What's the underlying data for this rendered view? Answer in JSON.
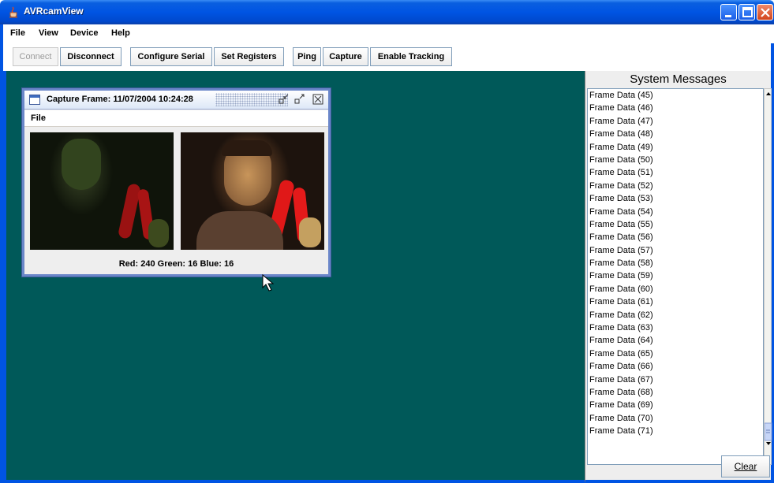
{
  "window": {
    "title": "AVRcamView"
  },
  "menubar": {
    "items": [
      {
        "label": "File",
        "mnemonic": "F"
      },
      {
        "label": "View",
        "mnemonic": "V"
      },
      {
        "label": "Device",
        "mnemonic": "D"
      },
      {
        "label": "Help",
        "mnemonic": "H"
      }
    ]
  },
  "toolbar": {
    "connect": "Connect",
    "disconnect": "Disconnect",
    "configure_serial": "Configure Serial",
    "set_registers": "Set Registers",
    "ping": "Ping",
    "capture": "Capture",
    "enable_tracking": "Enable Tracking"
  },
  "capture_frame": {
    "title": "Capture Frame: 11/07/2004 10:24:28",
    "menu_file": "File",
    "rgb_readout": "Red: 240 Green: 16 Blue: 16"
  },
  "system_messages": {
    "heading": "System Messages",
    "messages": [
      "Frame Data (45)",
      "Frame Data (46)",
      "Frame Data (47)",
      "Frame Data (48)",
      "Frame Data (49)",
      "Frame Data (50)",
      "Frame Data (51)",
      "Frame Data (52)",
      "Frame Data (53)",
      "Frame Data (54)",
      "Frame Data (55)",
      "Frame Data (56)",
      "Frame Data (57)",
      "Frame Data (58)",
      "Frame Data (59)",
      "Frame Data (60)",
      "Frame Data (61)",
      "Frame Data (62)",
      "Frame Data (63)",
      "Frame Data (64)",
      "Frame Data (65)",
      "Frame Data (66)",
      "Frame Data (67)",
      "Frame Data (68)",
      "Frame Data (69)",
      "Frame Data (70)",
      "Frame Data (71)"
    ],
    "clear_label": "Clear"
  },
  "colors": {
    "desktop": "#005959",
    "titlebar": "#0054e3",
    "frame_border": "#6a86c9"
  }
}
